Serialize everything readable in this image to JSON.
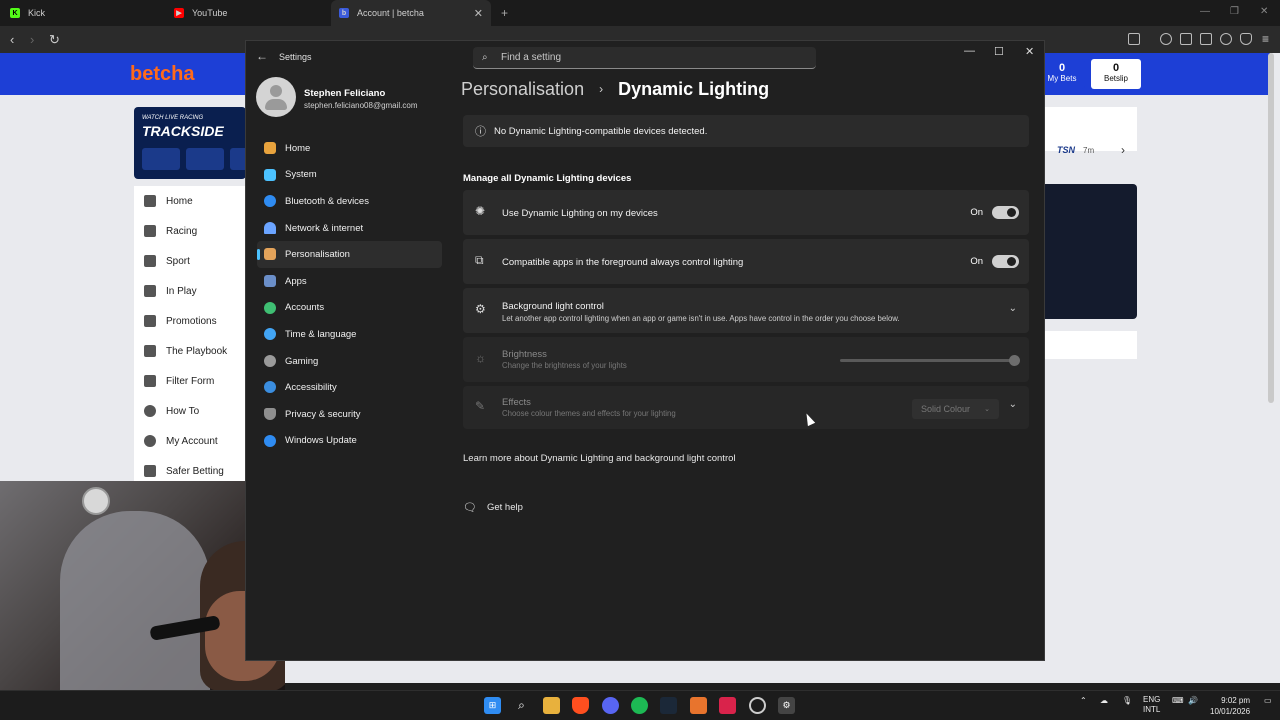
{
  "browser": {
    "tabs": [
      {
        "label": "Kick",
        "color": "#53fc18",
        "fav": "K"
      },
      {
        "label": "YouTube",
        "color": "#ff0000",
        "fav": "▶"
      },
      {
        "label": "Account | betcha",
        "color": "#3b5bdb",
        "fav": "b"
      }
    ]
  },
  "site": {
    "logo": "betcha",
    "my_bets": {
      "count": "0",
      "label": "My Bets"
    },
    "betslip": {
      "count": "0",
      "label": "Betslip"
    },
    "trackside": {
      "line1": "WATCH LIVE RACING",
      "line2": "TRACKSIDE"
    },
    "right_card_text": "7m",
    "nav": [
      "Home",
      "Racing",
      "Sport",
      "In Play",
      "Promotions",
      "The Playbook",
      "Filter Form",
      "How To",
      "My Account",
      "Safer Betting"
    ]
  },
  "settings": {
    "window_title": "Settings",
    "search_placeholder": "Find a setting",
    "user_name": "Stephen Feliciano",
    "user_email": "stephen.feliciano08@gmail.com",
    "menu": [
      {
        "label": "Home",
        "color": "#e8a33d"
      },
      {
        "label": "System",
        "color": "#4cc2ff"
      },
      {
        "label": "Bluetooth & devices",
        "color": "#2f8cf2"
      },
      {
        "label": "Network & internet",
        "color": "#6ba4ff"
      },
      {
        "label": "Personalisation",
        "color": "#e4a35a"
      },
      {
        "label": "Apps",
        "color": "#6b8fc9"
      },
      {
        "label": "Accounts",
        "color": "#3fbf73"
      },
      {
        "label": "Time & language",
        "color": "#42a5f5"
      },
      {
        "label": "Gaming",
        "color": "#9a9a9a"
      },
      {
        "label": "Accessibility",
        "color": "#3b8ee0"
      },
      {
        "label": "Privacy & security",
        "color": "#8f8f8f"
      },
      {
        "label": "Windows Update",
        "color": "#2f8cf2"
      }
    ],
    "active_menu": "Personalisation",
    "breadcrumb": {
      "parent": "Personalisation",
      "current": "Dynamic Lighting"
    },
    "notice": "No Dynamic Lighting-compatible devices detected.",
    "section_heading": "Manage all Dynamic Lighting devices",
    "use_dynamic": {
      "label": "Use Dynamic Lighting on my devices",
      "state": "On"
    },
    "compatible_apps": {
      "label": "Compatible apps in the foreground always control lighting",
      "state": "On"
    },
    "background_control": {
      "label": "Background light control",
      "sub": "Let another app control lighting when an app or game isn't in use. Apps have control in the order you choose below."
    },
    "brightness": {
      "label": "Brightness",
      "sub": "Change the brightness of your lights",
      "level": 1.0
    },
    "effects": {
      "label": "Effects",
      "sub": "Choose colour themes and effects for your lighting",
      "value": "Solid Colour"
    },
    "learn_more": "Learn more about Dynamic Lighting and background light control",
    "get_help": "Get help"
  },
  "taskbar": {
    "language": "ENG",
    "region": "INTL",
    "time": "9:02 pm",
    "date": "10/01/2026"
  }
}
